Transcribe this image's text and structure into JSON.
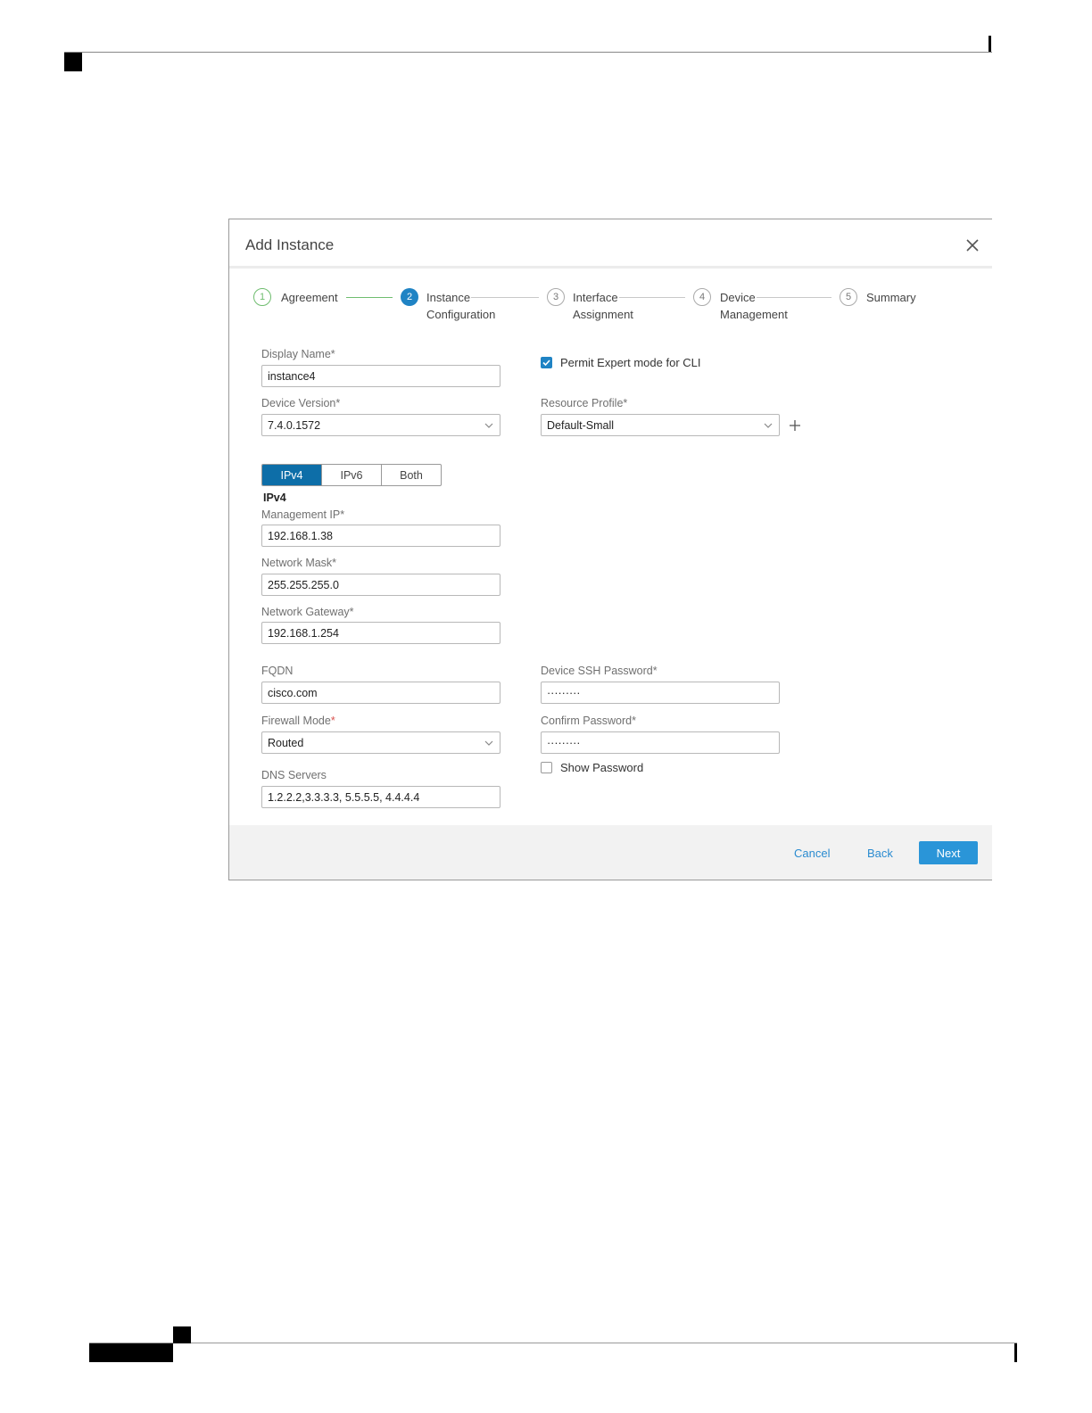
{
  "dialog": {
    "title": "Add Instance",
    "close_icon": "close-icon"
  },
  "wizard": {
    "steps": [
      {
        "number": "1",
        "label_line1": "Agreement",
        "label_line2": "",
        "state": "done"
      },
      {
        "number": "2",
        "label_line1": "Instance",
        "label_line2": "Configuration",
        "state": "active"
      },
      {
        "number": "3",
        "label_line1": "Interface",
        "label_line2": "Assignment",
        "state": "future"
      },
      {
        "number": "4",
        "label_line1": "Device",
        "label_line2": "Management",
        "state": "future"
      },
      {
        "number": "5",
        "label_line1": "Summary",
        "label_line2": "",
        "state": "future"
      }
    ]
  },
  "form": {
    "display_name": {
      "label": "Display Name*",
      "value": "instance4"
    },
    "expert_mode": {
      "label": "Permit Expert mode for CLI",
      "checked": true
    },
    "device_version": {
      "label": "Device Version*",
      "value": "7.4.0.1572"
    },
    "resource_profile": {
      "label": "Resource Profile*",
      "value": "Default-Small"
    },
    "ip_mode": {
      "options": [
        "IPv4",
        "IPv6",
        "Both"
      ],
      "selected": "IPv4"
    },
    "ipv4_heading": "IPv4",
    "management_ip": {
      "label": "Management IP*",
      "value": "192.168.1.38"
    },
    "network_mask": {
      "label": "Network Mask*",
      "value": "255.255.255.0"
    },
    "network_gateway": {
      "label": "Network Gateway*",
      "value": "192.168.1.254"
    },
    "fqdn": {
      "label": "FQDN",
      "value": "cisco.com"
    },
    "device_ssh_password": {
      "label": "Device SSH Password*",
      "value": "·········"
    },
    "firewall_mode": {
      "label": "Firewall Mode",
      "required_mark": "*",
      "value": "Routed"
    },
    "confirm_password": {
      "label": "Confirm Password*",
      "value": "·········"
    },
    "show_password": {
      "label": "Show Password",
      "checked": false
    },
    "dns_servers": {
      "label": "DNS Servers",
      "value": "1.2.2.2,3.3.3.3, 5.5.5.5,  4.4.4.4"
    }
  },
  "footer": {
    "cancel_label": "Cancel",
    "back_label": "Back",
    "next_label": "Next"
  },
  "colors": {
    "accent": "#1f83c4",
    "step_done": "#6fbd6f",
    "next_button": "#2a95d8"
  }
}
